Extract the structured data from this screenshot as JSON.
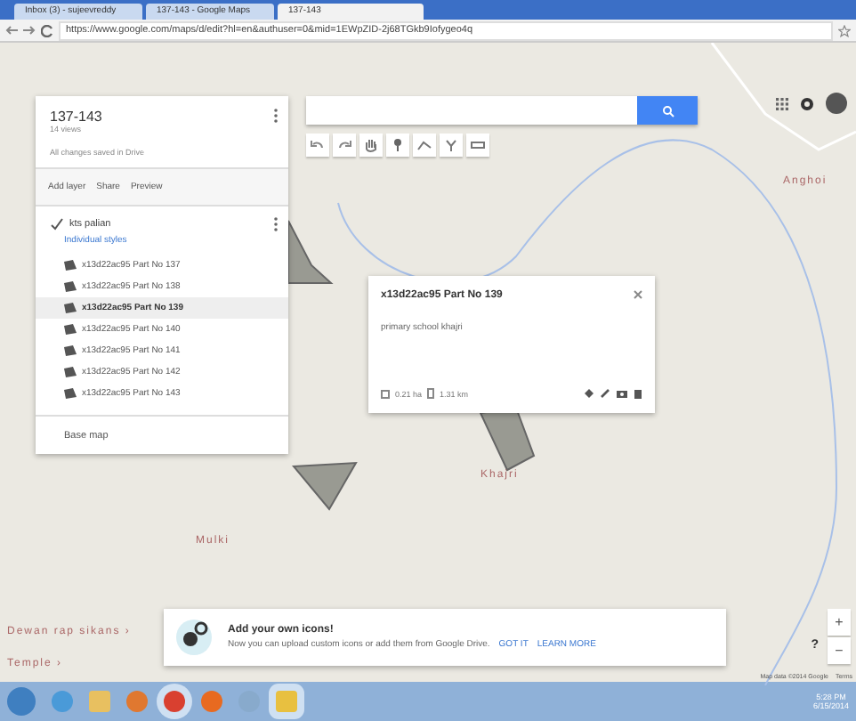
{
  "browser": {
    "tabs": [
      {
        "label": "Inbox (3) - sujeevreddy",
        "selected": false
      },
      {
        "label": "137-143 - Google Maps",
        "selected": false
      },
      {
        "label": "137-143",
        "selected": true
      }
    ],
    "url": "https://www.google.com/maps/d/edit?hl=en&authuser=0&mid=1EWpZID-2j68TGkb9Iofygeo4q"
  },
  "panel": {
    "title": "137-143",
    "views": "14 views",
    "status": "All changes saved in Drive",
    "actions": [
      "Add layer",
      "Share",
      "Preview"
    ],
    "layer": {
      "name": "kts palian",
      "checked": true,
      "style": "Individual styles",
      "items": [
        {
          "label": "x13d22ac95 Part No 137",
          "selected": false
        },
        {
          "label": "x13d22ac95 Part No 138",
          "selected": false
        },
        {
          "label": "x13d22ac95 Part No 139",
          "selected": true
        },
        {
          "label": "x13d22ac95 Part No 140",
          "selected": false
        },
        {
          "label": "x13d22ac95 Part No 141",
          "selected": false
        },
        {
          "label": "x13d22ac95 Part No 142",
          "selected": false
        },
        {
          "label": "x13d22ac95 Part No 143",
          "selected": false
        }
      ]
    },
    "base_map": "Base map"
  },
  "map_labels": [
    "Anghoi",
    "Khajri",
    "Mulki",
    "Dewan rap sikans ›",
    "Temple ›"
  ],
  "popup": {
    "title": "x13d22ac95 Part No 139",
    "description": "primary school khajri",
    "area": "0.21 ha",
    "perimeter": "1.31 km"
  },
  "notice": {
    "title": "Add your own icons!",
    "body": "Now you can upload custom icons or add them from Google Drive.",
    "buttons": [
      "GOT IT",
      "LEARN MORE"
    ]
  },
  "zoom": [
    "+",
    "−"
  ],
  "help": "?",
  "attribution": [
    "Map data ©2014 Google",
    "Terms"
  ],
  "taskbar": {
    "time": "5:28 PM",
    "date": "6/15/2014"
  }
}
